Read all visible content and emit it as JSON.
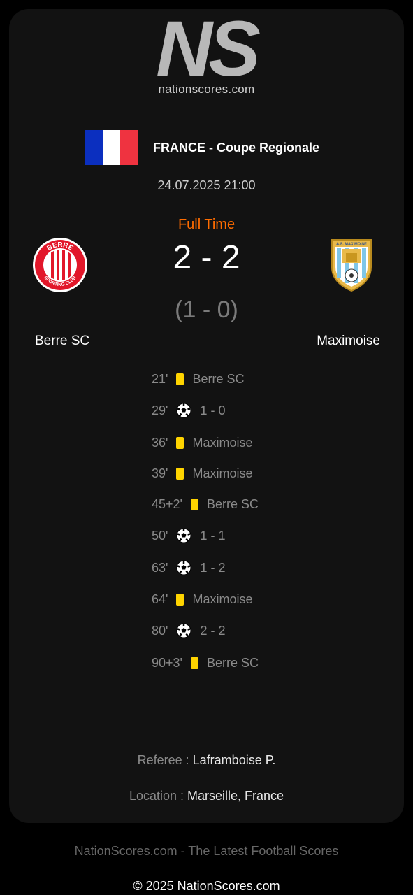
{
  "brand": {
    "logo_letters": "NS",
    "site": "nationscores.com"
  },
  "match": {
    "competition": "FRANCE - Coupe Regionale",
    "datetime": "24.07.2025 21:00",
    "status": "Full Time",
    "score": "2 - 2",
    "halftime": "(1 - 0)",
    "home": {
      "name": "Berre SC",
      "crest_text_top": "BERRE",
      "crest_text_bottom": "SPORTING CLUB"
    },
    "away": {
      "name": "Maximoise",
      "crest_text": "A.S. MAXIMOISE"
    }
  },
  "events": [
    {
      "minute": "21'",
      "type": "yellow",
      "text": "Berre SC"
    },
    {
      "minute": "29'",
      "type": "goal",
      "text": "1 - 0"
    },
    {
      "minute": "36'",
      "type": "yellow",
      "text": "Maximoise"
    },
    {
      "minute": "39'",
      "type": "yellow",
      "text": "Maximoise"
    },
    {
      "minute": "45+2'",
      "type": "yellow",
      "text": "Berre SC"
    },
    {
      "minute": "50'",
      "type": "goal",
      "text": "1 - 1"
    },
    {
      "minute": "63'",
      "type": "goal",
      "text": "1 - 2"
    },
    {
      "minute": "64'",
      "type": "yellow",
      "text": "Maximoise"
    },
    {
      "minute": "80'",
      "type": "goal",
      "text": "2 - 2"
    },
    {
      "minute": "90+3'",
      "type": "yellow",
      "text": "Berre SC"
    }
  ],
  "details": {
    "referee_label": "Referee :",
    "referee": "Laframboise P.",
    "location_label": "Location :",
    "location": "Marseille, France"
  },
  "footer": {
    "tagline": "NationScores.com - The Latest Football Scores",
    "copyright": "© 2025 NationScores.com"
  },
  "colors": {
    "status": "#ff6d00",
    "yellow_card": "#ffd400",
    "card_bg": "#121212"
  }
}
